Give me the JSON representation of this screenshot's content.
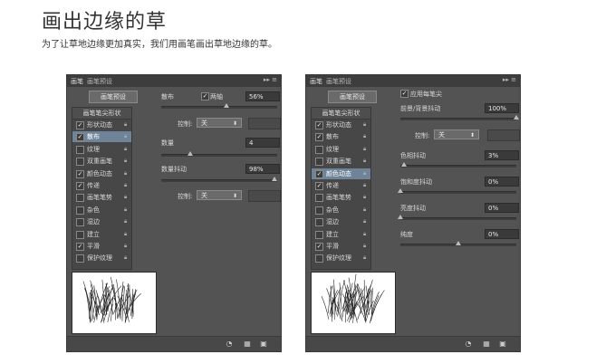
{
  "heading": {
    "title": "画出边缘的草",
    "subtitle": "为了让草地边缘更加真实，我们用画笔画出草地边缘的草。"
  },
  "left_panel": {
    "tabs": [
      "画笔",
      "画笔预设"
    ],
    "preset_button": "画笔预设",
    "list_header": "画笔笔尖形状",
    "items": [
      {
        "label": "形状动态",
        "checked": true,
        "selected": false
      },
      {
        "label": "散布",
        "checked": true,
        "selected": true
      },
      {
        "label": "纹理",
        "checked": false,
        "selected": false
      },
      {
        "label": "双重画笔",
        "checked": false,
        "selected": false
      },
      {
        "label": "颜色动态",
        "checked": true,
        "selected": false
      },
      {
        "label": "传递",
        "checked": true,
        "selected": false
      },
      {
        "label": "画笔笔势",
        "checked": false,
        "selected": false
      },
      {
        "label": "杂色",
        "checked": false,
        "selected": false
      },
      {
        "label": "湿边",
        "checked": false,
        "selected": false
      },
      {
        "label": "建立",
        "checked": false,
        "selected": false
      },
      {
        "label": "平滑",
        "checked": true,
        "selected": false
      },
      {
        "label": "保护纹理",
        "checked": false,
        "selected": false
      }
    ],
    "scatter_label": "散布",
    "both_axes_label": "两轴",
    "scatter_value": "56%",
    "scatter_control_label": "控制:",
    "scatter_control_value": "关",
    "count_label": "数量",
    "count_value": "4",
    "count_jitter_label": "数量抖动",
    "count_jitter_value": "98%",
    "count_control_label": "控制:",
    "count_control_value": "关",
    "scatter_level": 0.56,
    "count_level": 0.25,
    "count_jitter_level": 0.98
  },
  "right_panel": {
    "tabs": [
      "画笔",
      "画笔预设"
    ],
    "preset_button": "画笔预设",
    "apply_per_tip_label": "应用每笔尖",
    "list_header": "画笔笔尖形状",
    "items": [
      {
        "label": "形状动态",
        "checked": true,
        "selected": false
      },
      {
        "label": "散布",
        "checked": true,
        "selected": false
      },
      {
        "label": "纹理",
        "checked": false,
        "selected": false
      },
      {
        "label": "双重画笔",
        "checked": false,
        "selected": false
      },
      {
        "label": "颜色动态",
        "checked": true,
        "selected": true
      },
      {
        "label": "传递",
        "checked": true,
        "selected": false
      },
      {
        "label": "画笔笔势",
        "checked": false,
        "selected": false
      },
      {
        "label": "杂色",
        "checked": false,
        "selected": false
      },
      {
        "label": "湿边",
        "checked": false,
        "selected": false
      },
      {
        "label": "建立",
        "checked": false,
        "selected": false
      },
      {
        "label": "平滑",
        "checked": true,
        "selected": false
      },
      {
        "label": "保护纹理",
        "checked": false,
        "selected": false
      }
    ],
    "fg_bg_jitter_label": "前景/背景抖动",
    "fg_bg_jitter_value": "100%",
    "control_label": "控制:",
    "control_value": "关",
    "hue_jitter_label": "色相抖动",
    "hue_jitter_value": "3%",
    "saturation_jitter_label": "饱和度抖动",
    "saturation_jitter_value": "0%",
    "brightness_jitter_label": "亮度抖动",
    "brightness_jitter_value": "0%",
    "purity_label": "纯度",
    "purity_value": "0%",
    "fg_bg_level": 1.0,
    "hue_level": 0.03,
    "saturation_level": 0.0,
    "brightness_level": 0.0,
    "purity_level": 0.5
  },
  "colors": {
    "panel_bg": "#535353",
    "selected_item": "#6f8399",
    "text": "#d8d8d8"
  }
}
